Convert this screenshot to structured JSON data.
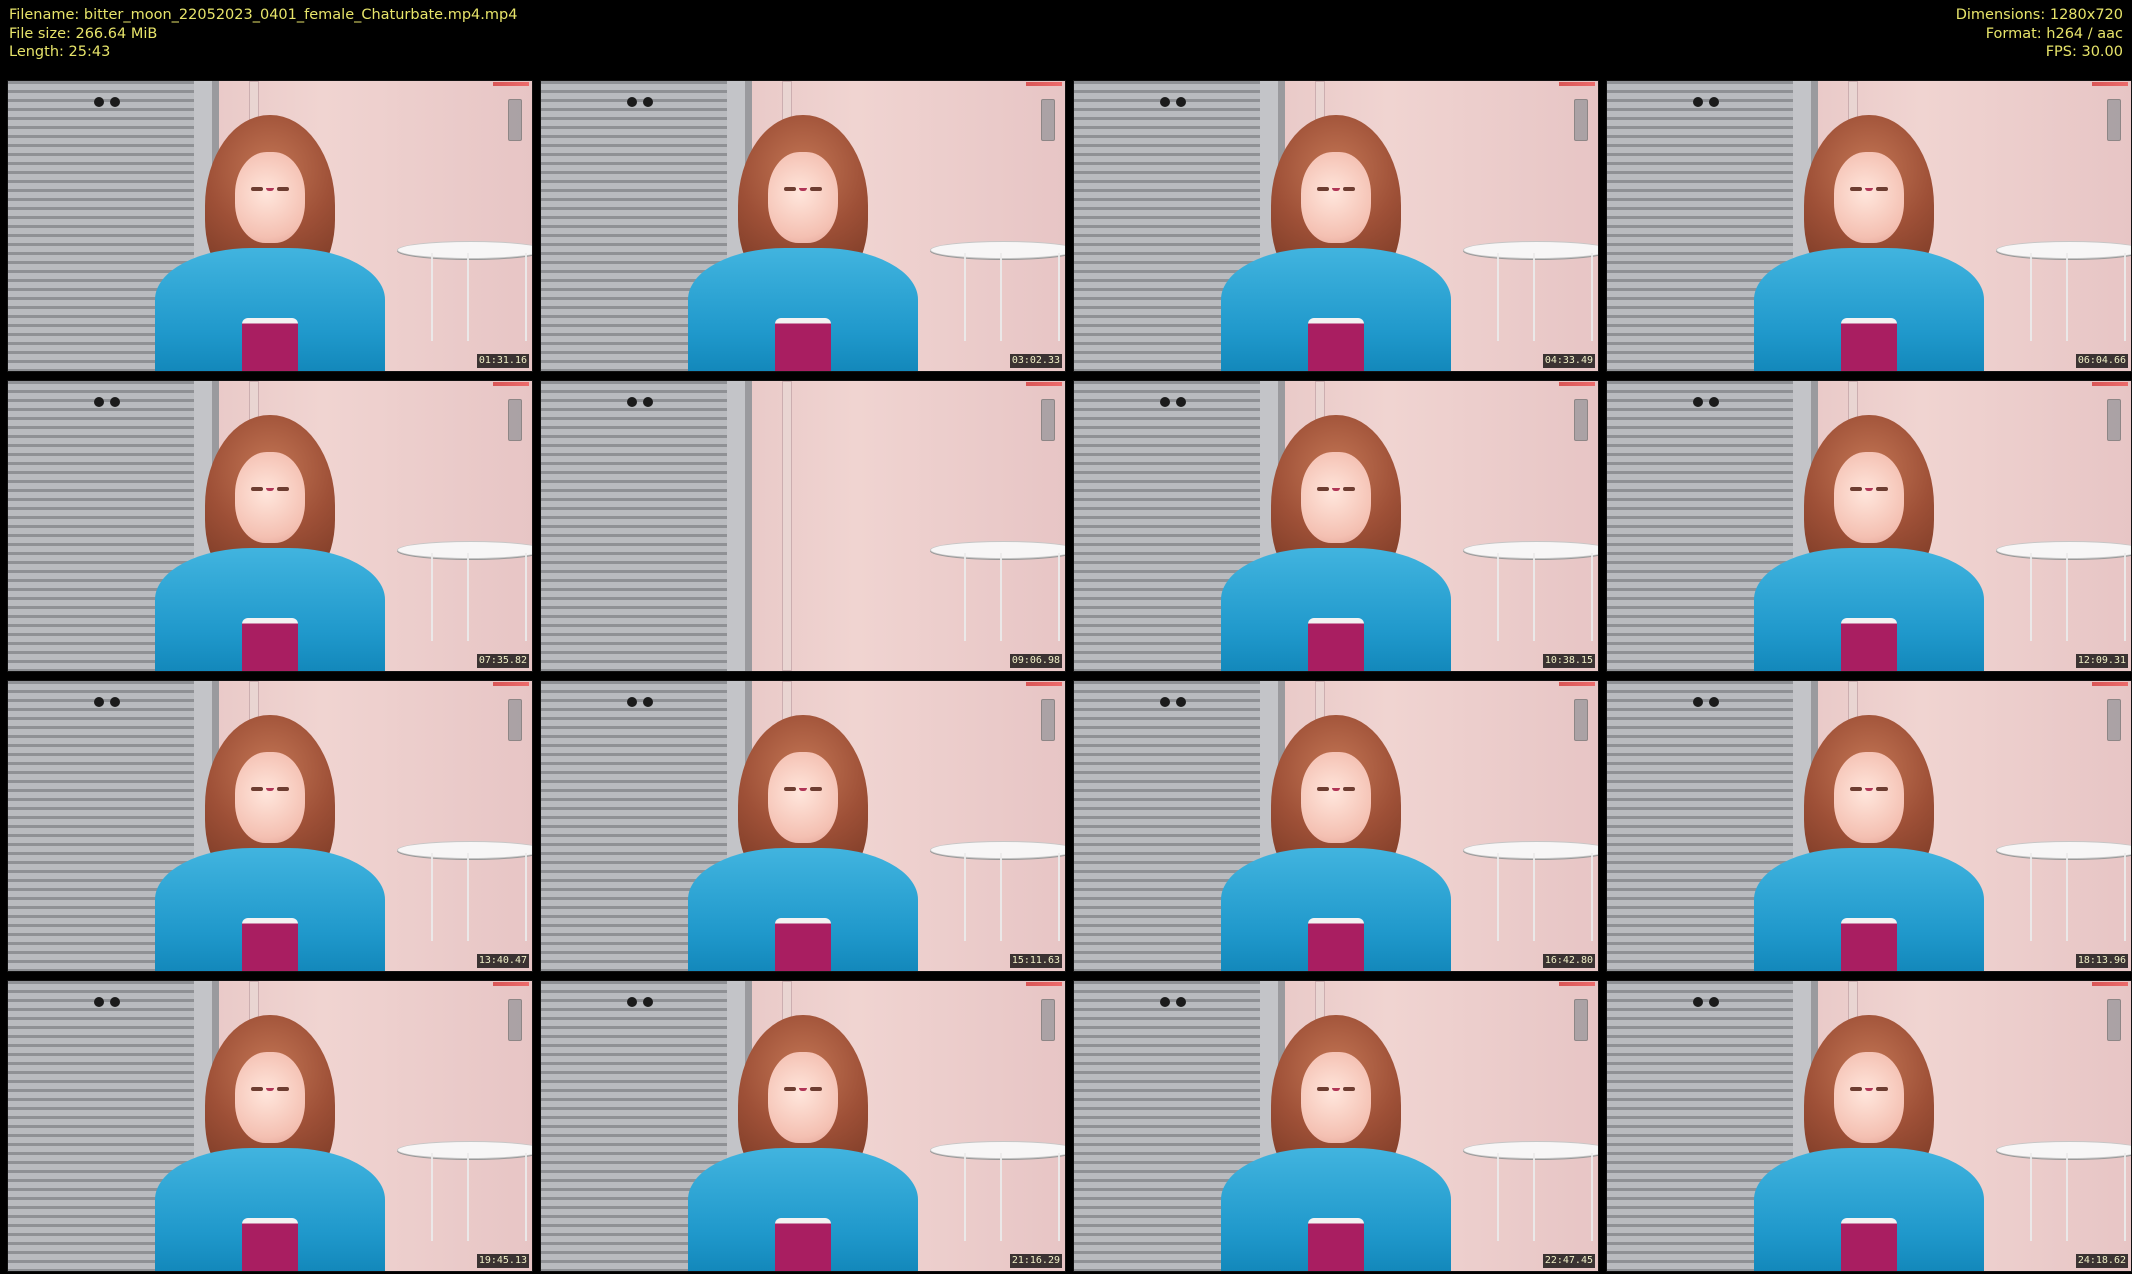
{
  "header": {
    "filename_line": "Filename: bitter_moon_22052023_0401_female_Chaturbate.mp4.mp4",
    "file_size_line": "File size: 266.64 MiB",
    "length_line": "Length: 25:43",
    "dimensions_line": "Dimensions: 1280x720",
    "format_line": "Format: h264 / aac",
    "fps_line": "FPS: 30.00"
  },
  "thumbnails": [
    {
      "timestamp": "01:31.16",
      "has_person": true
    },
    {
      "timestamp": "03:02.33",
      "has_person": true
    },
    {
      "timestamp": "04:33.49",
      "has_person": true
    },
    {
      "timestamp": "06:04.66",
      "has_person": true
    },
    {
      "timestamp": "07:35.82",
      "has_person": true
    },
    {
      "timestamp": "09:06.98",
      "has_person": false
    },
    {
      "timestamp": "10:38.15",
      "has_person": true
    },
    {
      "timestamp": "12:09.31",
      "has_person": true
    },
    {
      "timestamp": "13:40.47",
      "has_person": true
    },
    {
      "timestamp": "15:11.63",
      "has_person": true
    },
    {
      "timestamp": "16:42.80",
      "has_person": true
    },
    {
      "timestamp": "18:13.96",
      "has_person": true
    },
    {
      "timestamp": "19:45.13",
      "has_person": true
    },
    {
      "timestamp": "21:16.29",
      "has_person": true
    },
    {
      "timestamp": "22:47.45",
      "has_person": true
    },
    {
      "timestamp": "24:18.62",
      "has_person": true
    }
  ]
}
